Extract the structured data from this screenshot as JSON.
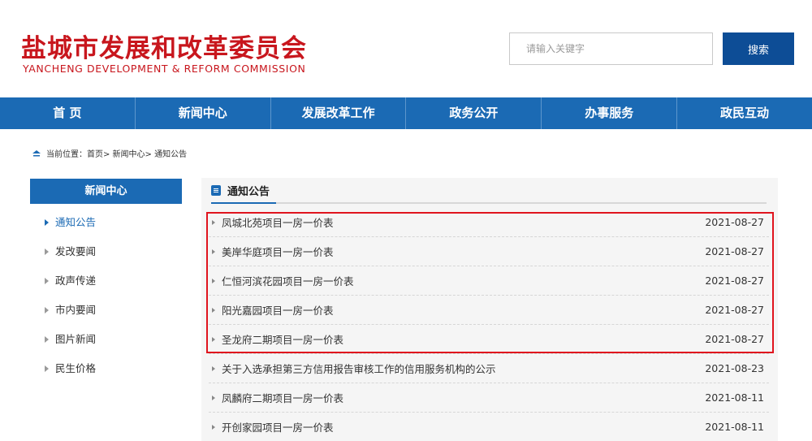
{
  "header": {
    "logo_cn": "盐城市发展和改革委员会",
    "logo_en": "YANCHENG DEVELOPMENT & REFORM COMMISSION",
    "search_placeholder": "请输入关键字",
    "search_button": "搜索"
  },
  "nav": {
    "items": [
      {
        "label": "首 页"
      },
      {
        "label": "新闻中心"
      },
      {
        "label": "发展改革工作"
      },
      {
        "label": "政务公开"
      },
      {
        "label": "办事服务"
      },
      {
        "label": "政民互动"
      }
    ]
  },
  "breadcrumb": {
    "prefix": "当前位置：",
    "text": "首页> 新闻中心> 通知公告"
  },
  "sidebar": {
    "title": "新闻中心",
    "items": [
      {
        "label": "通知公告",
        "active": true
      },
      {
        "label": "发改要闻",
        "active": false
      },
      {
        "label": "政声传递",
        "active": false
      },
      {
        "label": "市内要闻",
        "active": false
      },
      {
        "label": "图片新闻",
        "active": false
      },
      {
        "label": "民生价格",
        "active": false
      }
    ]
  },
  "main": {
    "section_title": "通知公告",
    "highlight_color": "#e0141e",
    "items": [
      {
        "title": "凤城北苑项目一房一价表",
        "date": "2021-08-27"
      },
      {
        "title": "美岸华庭项目一房一价表",
        "date": "2021-08-27"
      },
      {
        "title": "仁恒河滨花园项目一房一价表",
        "date": "2021-08-27"
      },
      {
        "title": "阳光嘉园项目一房一价表",
        "date": "2021-08-27"
      },
      {
        "title": "圣龙府二期项目一房一价表",
        "date": "2021-08-27"
      },
      {
        "title": "关于入选承担第三方信用报告审核工作的信用服务机构的公示",
        "date": "2021-08-23"
      },
      {
        "title": "凤麟府二期项目一房一价表",
        "date": "2021-08-11"
      },
      {
        "title": "开创家园项目一房一价表",
        "date": "2021-08-11"
      }
    ]
  },
  "colors": {
    "brand_red": "#c8161d",
    "nav_blue": "#1b6ab4",
    "search_blue": "#0d4d96"
  },
  "icons": {
    "breadcrumb": "home-icon",
    "section": "document-icon",
    "list_bullet": "triangle-right-icon"
  }
}
